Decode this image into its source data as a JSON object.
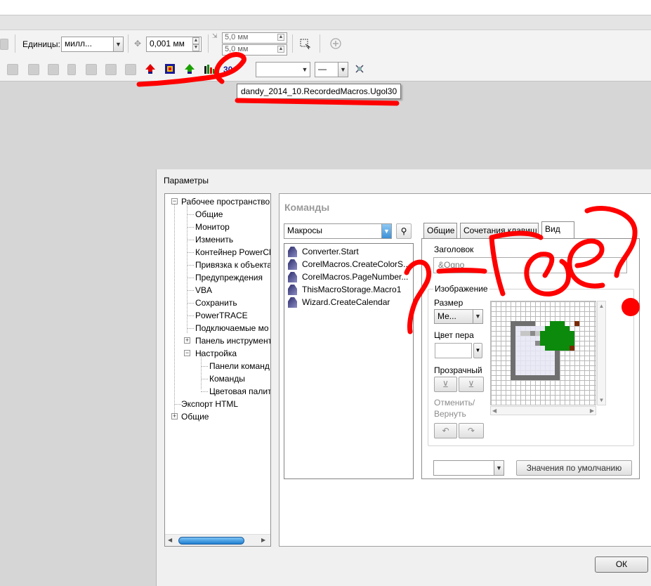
{
  "toolbar": {
    "units_label": "Единицы:",
    "units_value": "милл...",
    "nudge_value": "0,001 мм",
    "dup_x": "5,0 мм",
    "dup_y": "5,0 мм",
    "line_value": "—"
  },
  "tooltip": "dandy_2014_10.RecordedMacros.Ugol30",
  "dialog": {
    "title": "Параметры",
    "tree": [
      "Рабочее пространство",
      "Общие",
      "Монитор",
      "Изменить",
      "Контейнер PowerCl",
      "Привязка к объекта",
      "Предупреждения",
      "VBA",
      "Сохранить",
      "PowerTRACE",
      "Подключаемые мо",
      "Панель инструмент",
      "Настройка",
      "Панели команд",
      "Команды",
      "Цветовая палитр",
      "Экспорт HTML",
      "Общие"
    ],
    "panel_title": "Команды",
    "category": "Макросы",
    "macros": [
      "Converter.Start",
      "CorelMacros.CreateColorS...",
      "CorelMacros.PageNumber...",
      "ThisMacroStorage.Macro1",
      "Wizard.CreateCalendar"
    ],
    "tabs": [
      "Общие",
      "Сочетания клавиш",
      "Вид"
    ],
    "heading_label": "Заголовок",
    "heading_value": "&Ogno",
    "image_label": "Изображение",
    "size_label": "Размер",
    "size_value": "Ме...",
    "pen_color_label": "Цвет пера",
    "transparent_label": "Прозрачный",
    "undo_redo_label_1": "Отменить/",
    "undo_redo_label_2": "Вернуть",
    "defaults_button": "Значения по умолчанию",
    "ok_button": "ОК"
  },
  "annotation": {
    "scribble_text": "?-где?",
    "ink_color": "#ff0000"
  }
}
